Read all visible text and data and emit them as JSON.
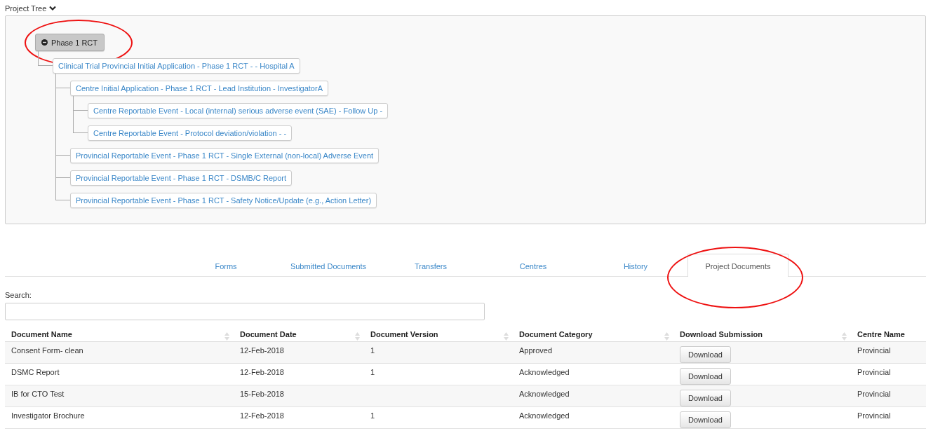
{
  "project_tree": {
    "label": "Project Tree",
    "expanded": true,
    "root": {
      "label": "Phase 1 RCT",
      "expanded": true,
      "circled": true,
      "children": [
        {
          "label": "Clinical Trial Provincial Initial Application - Phase 1 RCT - - Hospital A",
          "children": [
            {
              "label": "Centre Initial Application - Phase 1 RCT - Lead Institution - InvestigatorA",
              "children": [
                {
                  "label": "Centre Reportable Event - Local (internal) serious adverse event (SAE) - Follow Up -"
                },
                {
                  "label": "Centre Reportable Event - Protocol deviation/violation - -"
                }
              ]
            },
            {
              "label": "Provincial Reportable Event - Phase 1 RCT - Single External (non-local) Adverse Event"
            },
            {
              "label": "Provincial Reportable Event - Phase 1 RCT - DSMB/C Report"
            },
            {
              "label": "Provincial Reportable Event - Phase 1 RCT - Safety Notice/Update (e.g., Action Letter)"
            }
          ]
        }
      ]
    }
  },
  "tabs": [
    {
      "label": "Forms",
      "selected": false,
      "circled": false
    },
    {
      "label": "Submitted Documents",
      "selected": false,
      "circled": false
    },
    {
      "label": "Transfers",
      "selected": false,
      "circled": false
    },
    {
      "label": "Centres",
      "selected": false,
      "circled": false
    },
    {
      "label": "History",
      "selected": false,
      "circled": false
    },
    {
      "label": "Project Documents",
      "selected": true,
      "circled": true
    }
  ],
  "search": {
    "label": "Search:"
  },
  "table": {
    "columns": [
      "Document Name",
      "Document Date",
      "Document Version",
      "Document Category",
      "Download Submission",
      "Centre Name"
    ],
    "rows": [
      [
        "Consent Form- clean",
        "12-Feb-2018",
        "1",
        "Approved",
        "Download",
        "Provincial"
      ],
      [
        "DSMC Report",
        "12-Feb-2018",
        "1",
        "Acknowledged",
        "Download",
        "Provincial"
      ],
      [
        "IB for CTO Test",
        "15-Feb-2018",
        "",
        "Acknowledged",
        "Download",
        "Provincial"
      ],
      [
        "Investigator Brochure",
        "12-Feb-2018",
        "1",
        "Acknowledged",
        "Download",
        "Provincial"
      ]
    ]
  }
}
